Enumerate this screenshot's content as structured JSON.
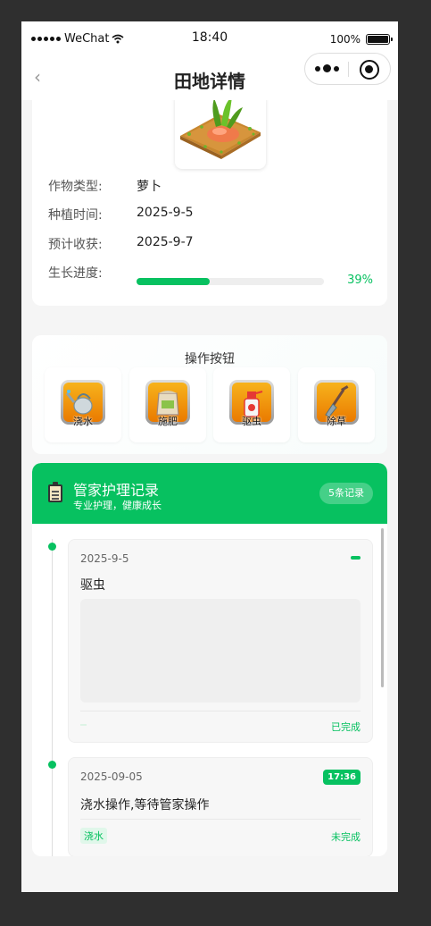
{
  "status_bar": {
    "carrier": "WeChat",
    "time": "18:40",
    "battery": "100%"
  },
  "nav": {
    "title": "田地详情",
    "back_glyph": "‹"
  },
  "field": {
    "crop_type_label": "作物类型:",
    "crop_type": "萝卜",
    "plant_time_label": "种植时间:",
    "plant_time": "2025-9-5",
    "harvest_label": "预计收获:",
    "harvest": "2025-9-7",
    "progress_label": "生长进度:",
    "progress_text": "39%",
    "progress": 0.39
  },
  "operations": {
    "title": "操作按钮",
    "items": [
      {
        "label": "浇水",
        "icon": "watering-can-icon"
      },
      {
        "label": "施肥",
        "icon": "fertilizer-bag-icon"
      },
      {
        "label": "驱虫",
        "icon": "spray-bottle-icon"
      },
      {
        "label": "除草",
        "icon": "shovel-icon"
      }
    ]
  },
  "records": {
    "title": "管家护理记录",
    "subtitle": "专业护理，健康成长",
    "count": "5条记录",
    "entries": [
      {
        "date": "2025-9-5",
        "text": "驱虫",
        "status": "已完成"
      },
      {
        "date": "2025-09-05",
        "time": "17:36",
        "text": "浇水操作,等待管家操作",
        "tag": "浇水",
        "status": "未完成"
      }
    ]
  },
  "colors": {
    "accent": "#07c160",
    "background": "#f5f5f5",
    "card": "#ffffff"
  }
}
